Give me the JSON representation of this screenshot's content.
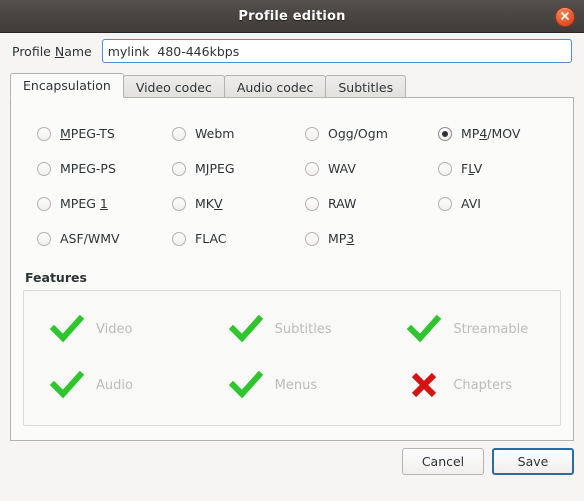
{
  "window": {
    "title": "Profile edition",
    "close_icon": "close-icon"
  },
  "profile_name": {
    "label_prefix": "Profile ",
    "label_mnemonic": "N",
    "label_suffix": "ame",
    "value": "mylink  480-446kbps",
    "placeholder": "Profile Name"
  },
  "tabs": [
    {
      "label": "Encapsulation",
      "active": true
    },
    {
      "label": "Video codec",
      "active": false
    },
    {
      "label": "Audio codec",
      "active": false
    },
    {
      "label": "Subtitles",
      "active": false
    }
  ],
  "encapsulation": {
    "options": [
      {
        "pre": "",
        "mnemonic": "M",
        "post": "PEG-TS",
        "checked": false,
        "name": "mpeg-ts"
      },
      {
        "pre": "",
        "mnemonic": "",
        "post": "Webm",
        "checked": false,
        "name": "webm"
      },
      {
        "pre": "",
        "mnemonic": "",
        "post": "Ogg/Ogm",
        "checked": false,
        "name": "ogg-ogm"
      },
      {
        "pre": "MP",
        "mnemonic": "4",
        "post": "/MOV",
        "checked": true,
        "name": "mp4-mov"
      },
      {
        "pre": "",
        "mnemonic": "",
        "post": "MPEG-PS",
        "checked": false,
        "name": "mpeg-ps"
      },
      {
        "pre": "M",
        "mnemonic": "J",
        "post": "PEG",
        "checked": false,
        "name": "mjpeg"
      },
      {
        "pre": "",
        "mnemonic": "",
        "post": "WAV",
        "checked": false,
        "name": "wav"
      },
      {
        "pre": "F",
        "mnemonic": "L",
        "post": "V",
        "checked": false,
        "name": "flv"
      },
      {
        "pre": "MPEG ",
        "mnemonic": "1",
        "post": "",
        "checked": false,
        "name": "mpeg-1"
      },
      {
        "pre": "MK",
        "mnemonic": "V",
        "post": "",
        "checked": false,
        "name": "mkv"
      },
      {
        "pre": "",
        "mnemonic": "",
        "post": "RAW",
        "checked": false,
        "name": "raw"
      },
      {
        "pre": "",
        "mnemonic": "",
        "post": "AVI",
        "checked": false,
        "name": "avi"
      },
      {
        "pre": "",
        "mnemonic": "",
        "post": "ASF/WMV",
        "checked": false,
        "name": "asf-wmv"
      },
      {
        "pre": "",
        "mnemonic": "",
        "post": "FLAC",
        "checked": false,
        "name": "flac"
      },
      {
        "pre": "MP",
        "mnemonic": "3",
        "post": "",
        "checked": false,
        "name": "mp3"
      },
      {
        "pre": "",
        "mnemonic": "",
        "post": "",
        "checked": false,
        "name": "empty"
      }
    ]
  },
  "features": {
    "title": "Features",
    "items": [
      {
        "label": "Video",
        "state": "supported",
        "icon": "check-icon"
      },
      {
        "label": "Subtitles",
        "state": "supported",
        "icon": "check-icon"
      },
      {
        "label": "Streamable",
        "state": "supported",
        "icon": "check-icon"
      },
      {
        "label": "Audio",
        "state": "supported",
        "icon": "check-icon"
      },
      {
        "label": "Menus",
        "state": "supported",
        "icon": "check-icon"
      },
      {
        "label": "Chapters",
        "state": "not-supported",
        "icon": "cross-icon"
      }
    ]
  },
  "actions": {
    "cancel_label": "Cancel",
    "save_label": "Save"
  },
  "colors": {
    "titlebar_dark": "#4a4643",
    "close_button": "#e4572e",
    "focus_blue": "#4a90d9",
    "save_focus_border": "#2d6ba3",
    "check_green": "#2ec52e",
    "cross_red": "#d41414",
    "feature_label_gray": "#bcbcbc",
    "panel_bg": "#fbfbfa",
    "dialog_bg": "#f6f5f4"
  }
}
